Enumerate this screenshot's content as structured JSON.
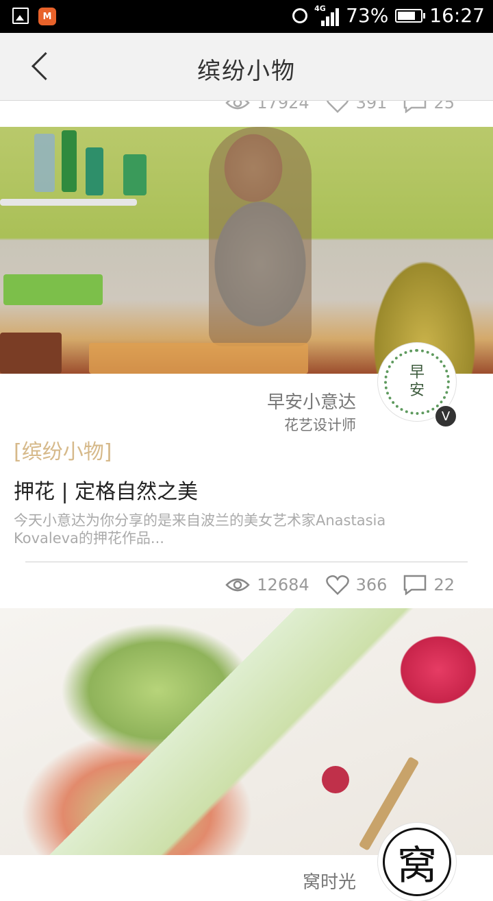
{
  "status_bar": {
    "battery": "73%",
    "time": "16:27",
    "network": "4G"
  },
  "header": {
    "title": "缤纷小物"
  },
  "previous_card": {
    "views": "17924",
    "likes": "391",
    "comments": "25"
  },
  "card1": {
    "author_name": "早安小意达",
    "author_role": "花艺设计师",
    "avatar_text": "早安",
    "badge": "V",
    "category": "[缤纷小物]",
    "title": "押花 | 定格自然之美",
    "summary": "今天小意达为你分享的是来自波兰的美女艺术家Anastasia Kovaleva的押花作品...",
    "views": "12684",
    "likes": "366",
    "comments": "22"
  },
  "card2": {
    "author_name": "窝时光",
    "avatar_text": "窝"
  },
  "icons": {
    "views": "eye-icon",
    "likes": "heart-icon",
    "comments": "comment-icon",
    "back": "chevron-left-icon"
  },
  "colors": {
    "category": "#d6b98a",
    "header_bg": "#f2f2f2"
  }
}
